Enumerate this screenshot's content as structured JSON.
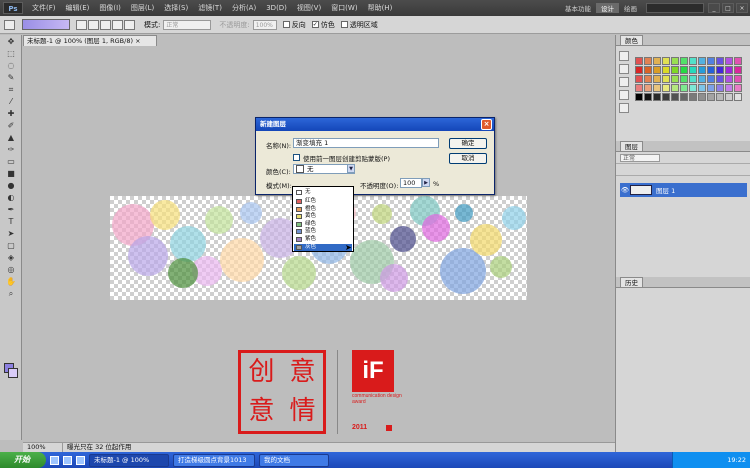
{
  "app": {
    "logo": "Ps",
    "menus": [
      "文件(F)",
      "编辑(E)",
      "图像(I)",
      "图层(L)",
      "选择(S)",
      "滤镜(T)",
      "分析(A)",
      "3D(D)",
      "视图(V)",
      "窗口(W)",
      "帮助(H)"
    ],
    "workspaces": [
      "基本功能",
      "设计",
      "绘画"
    ],
    "active_workspace": "设计",
    "window_buttons": [
      "_",
      "□",
      "×"
    ]
  },
  "options": {
    "mode_label": "模式:",
    "mode_value": "正常",
    "opacity_label": "不透明度:",
    "opacity_value": "100%",
    "reverse_label": "反向",
    "dither_label": "仿色",
    "transparency_label": "透明区域"
  },
  "document": {
    "tab_title": "未标题-1 @ 100% (图层 1, RGB/8) ×",
    "zoom": "100%",
    "status_text": "曝光只在 32 位起作用"
  },
  "dialog": {
    "title": "新建图层",
    "name_label": "名称(N):",
    "name_value": "渐变填充 1",
    "ok_label": "确定",
    "cancel_label": "取消",
    "clip_label": "使用前一图层创建剪贴蒙版(P)",
    "color_label": "颜色(C):",
    "color_value": "无",
    "mode_label": "模式(M):",
    "opacity_label": "不透明度(O):",
    "opacity_value": "100",
    "opacity_unit": "%"
  },
  "color_dropdown": {
    "options": [
      {
        "label": "无",
        "color": "#ffffff"
      },
      {
        "label": "红色",
        "color": "#e06060"
      },
      {
        "label": "橙色",
        "color": "#e8a060"
      },
      {
        "label": "黄色",
        "color": "#e8e070"
      },
      {
        "label": "绿色",
        "color": "#80c080"
      },
      {
        "label": "蓝色",
        "color": "#7090d0"
      },
      {
        "label": "紫色",
        "color": "#a080c0"
      },
      {
        "label": "灰色",
        "color": "#a0a0a0"
      }
    ],
    "selected": "灰色"
  },
  "panels": {
    "color_tab": "颜色",
    "layers_tab": "图层",
    "layers_mode": "正常",
    "layer_name": "图层 1",
    "history_tab": "历史"
  },
  "logos": {
    "seal_chars": [
      "创",
      "意",
      "意",
      "情"
    ],
    "if_mark": "iF",
    "if_text": "communication design award",
    "if_year": "2011"
  },
  "taskbar": {
    "start_label": "开始",
    "buttons": [
      "未标题-1 @ 100%",
      "打造梯级圆点背景1013",
      "我的文档"
    ],
    "clock": "19:22"
  },
  "colors": {
    "accent": "#316ac5",
    "brand_red": "#d91b1b",
    "foreground": "#8c80e0",
    "background": "#d9ccf8"
  }
}
